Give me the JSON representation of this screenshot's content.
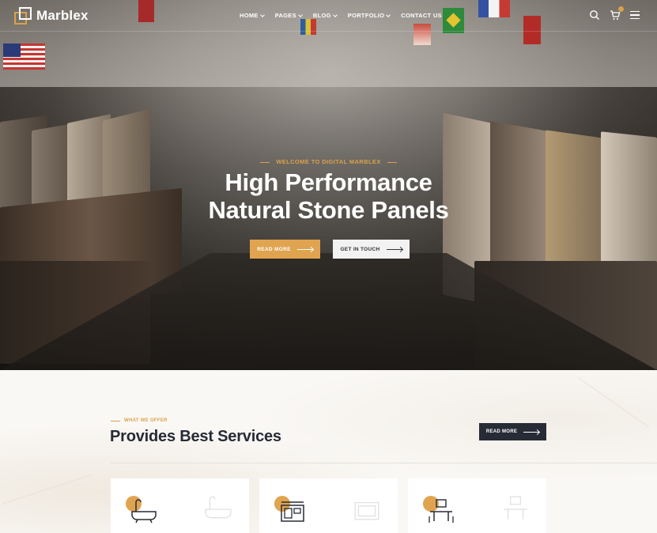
{
  "header": {
    "logo_text": "Marblex",
    "nav": [
      {
        "label": "HOME",
        "has_dropdown": true
      },
      {
        "label": "PAGES",
        "has_dropdown": true
      },
      {
        "label": "BLOG",
        "has_dropdown": true
      },
      {
        "label": "PORTFOLIO",
        "has_dropdown": true
      },
      {
        "label": "CONTACT US",
        "has_dropdown": false
      }
    ],
    "icons": [
      "search-icon",
      "cart-icon",
      "menu-icon"
    ]
  },
  "hero": {
    "eyebrow": "WELCOME TO DIGITAL MARBLEX",
    "title_line1": "High Performance",
    "title_line2": "Natural Stone Panels",
    "primary_button": "READ MORE",
    "secondary_button": "GET IN TOUCH"
  },
  "services": {
    "kicker": "WHAT WE OFFER",
    "title": "Provides Best Services",
    "button": "READ MORE",
    "cards": [
      {
        "icon": "bathtub-icon"
      },
      {
        "icon": "kitchen-icon"
      },
      {
        "icon": "dining-table-icon"
      }
    ]
  },
  "colors": {
    "accent": "#e0a450",
    "dark": "#262c36"
  }
}
